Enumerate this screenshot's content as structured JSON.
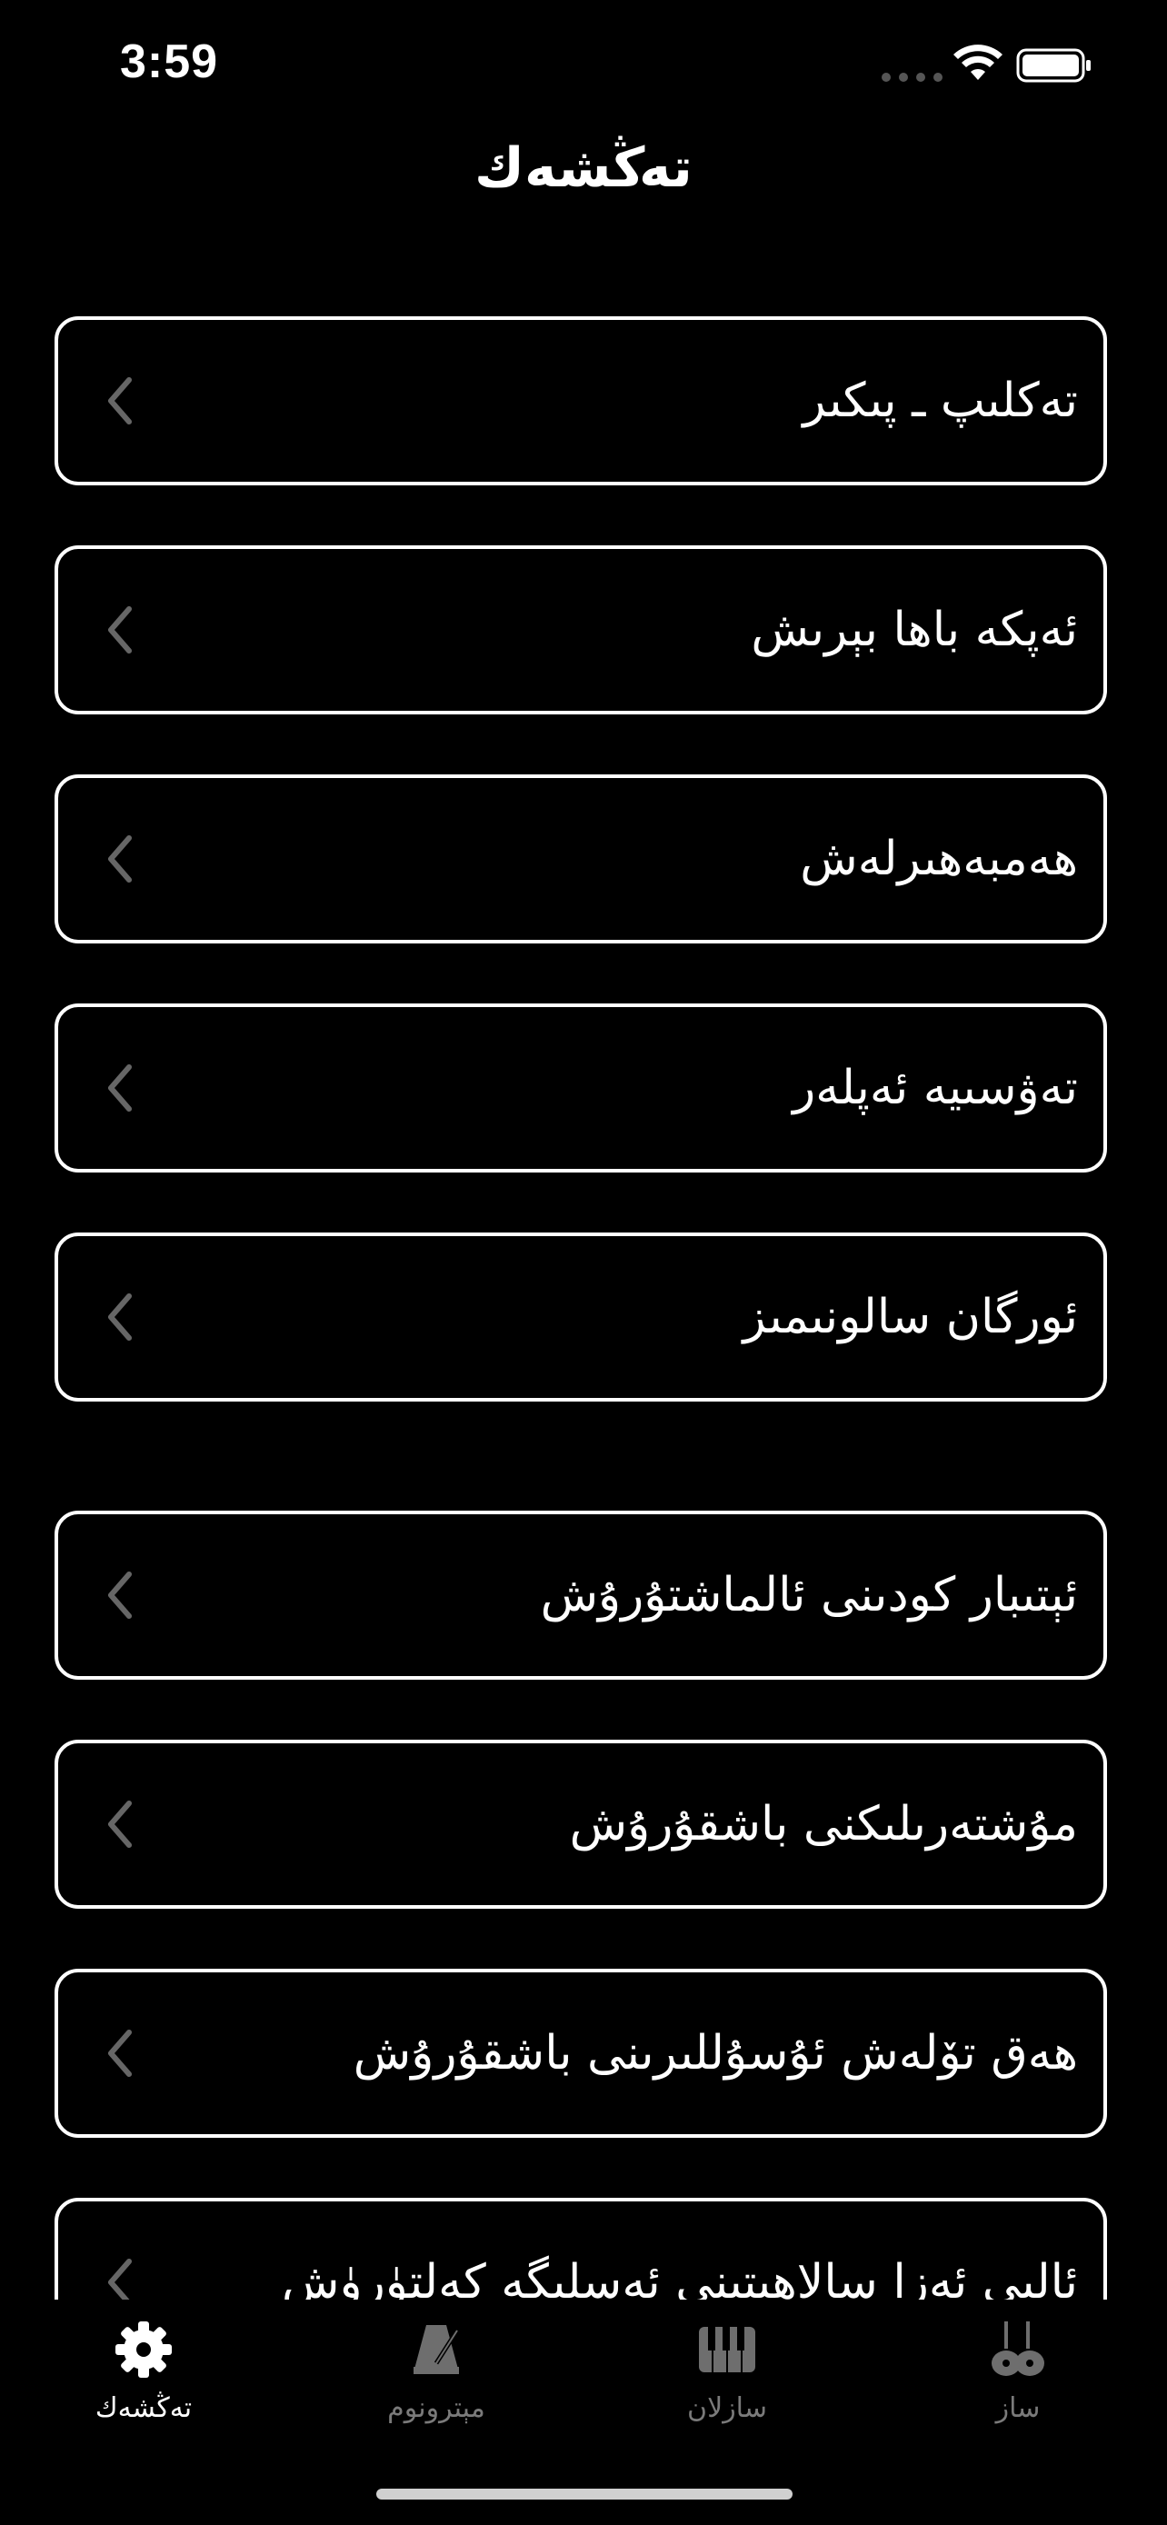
{
  "status_bar": {
    "time": "3:59"
  },
  "header": {
    "title": "تەڭشەك"
  },
  "settings_list": [
    {
      "label": "تەكلىپ ـ پىكىر"
    },
    {
      "label": "ئەپكە باھا بېرىش"
    },
    {
      "label": "ھەمبەھىرلەش"
    },
    {
      "label": "تەۋسىيە ئەپلەر"
    },
    {
      "label": "ئورگان سالونىمىز"
    },
    {
      "label": "ئېتىبار كودىنى ئالماشتۇرۇش"
    },
    {
      "label": "مۇشتەرىلىكنى باشقۇرۇش"
    },
    {
      "label": "ھەق تۆلەش ئۇسۇللىرىنى باشقۇرۇش"
    },
    {
      "label": "ئالىي ئەزا سالاھىتىنى ئەسلىگە كەلتۈرۈش"
    }
  ],
  "tab_bar": {
    "tabs": [
      {
        "label": "تەڭشەك",
        "icon": "gear-icon",
        "active": true
      },
      {
        "label": "مېترونوم",
        "icon": "metronome-icon",
        "active": false
      },
      {
        "label": "سازلان",
        "icon": "piano-icon",
        "active": false
      },
      {
        "label": "ساز",
        "icon": "instruments-icon",
        "active": false
      }
    ]
  },
  "colors": {
    "background": "#000000",
    "foreground": "#ffffff",
    "inactive_tab": "#7a7a7a"
  }
}
